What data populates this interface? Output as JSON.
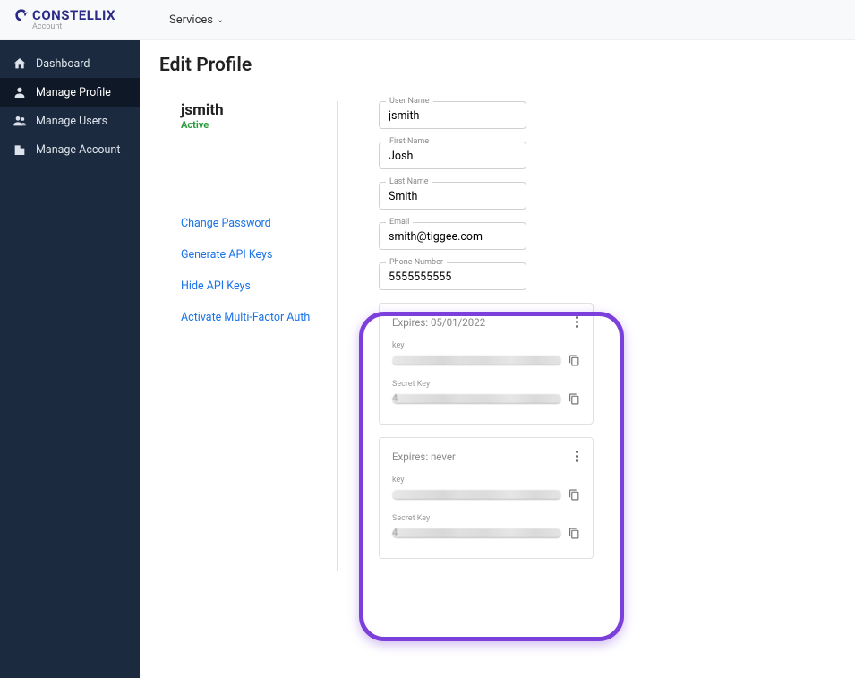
{
  "brand": {
    "name": "CONSTELLIX",
    "sub": "Account"
  },
  "topbar": {
    "services_label": "Services"
  },
  "sidebar": {
    "items": [
      {
        "label": "Dashboard",
        "icon": "home-icon"
      },
      {
        "label": "Manage Profile",
        "icon": "person-icon",
        "active": true
      },
      {
        "label": "Manage Users",
        "icon": "people-icon"
      },
      {
        "label": "Manage Account",
        "icon": "building-icon"
      }
    ]
  },
  "page": {
    "title": "Edit Profile",
    "user": "jsmith",
    "status": "Active",
    "links": {
      "change_password": "Change Password",
      "generate_api_keys": "Generate API Keys",
      "hide_api_keys": "Hide API Keys",
      "activate_mfa": "Activate Multi-Factor Auth"
    },
    "fields": {
      "username_label": "User Name",
      "username_value": "jsmith",
      "firstname_label": "First Name",
      "firstname_value": "Josh",
      "lastname_label": "Last Name",
      "lastname_value": "Smith",
      "email_label": "Email",
      "email_value": "smith@tiggee.com",
      "phone_label": "Phone Number",
      "phone_value": "5555555555"
    },
    "api_keys": [
      {
        "expires_label": "Expires: 05/01/2022",
        "key_label": "key",
        "secret_label": "Secret Key"
      },
      {
        "expires_label": "Expires: never",
        "key_label": "key",
        "secret_label": "Secret Key"
      }
    ]
  }
}
